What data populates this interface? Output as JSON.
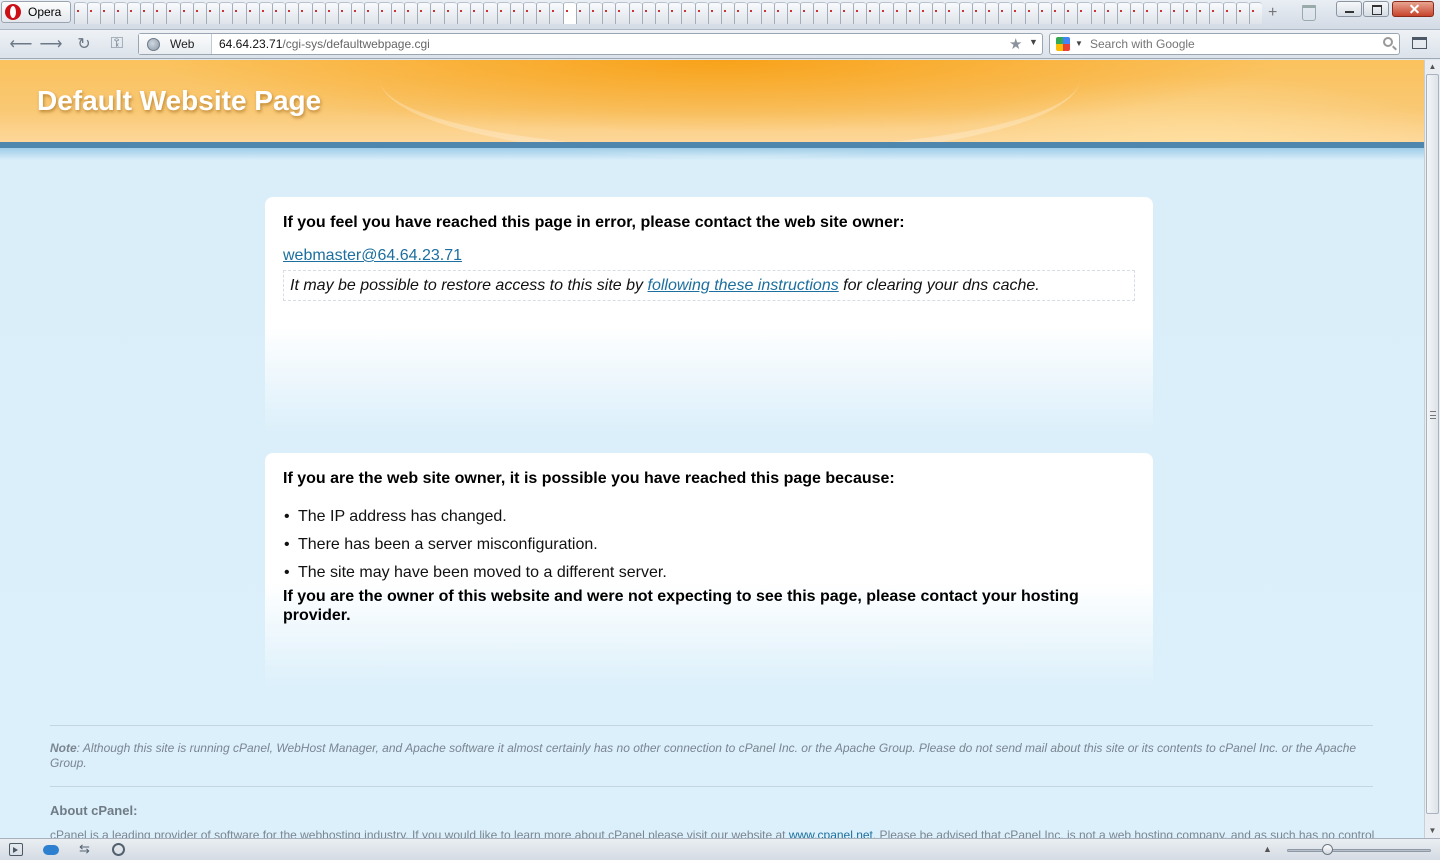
{
  "browser": {
    "menu_label": "Opera",
    "tab_count": 90,
    "site_badge_label": "Web",
    "address": {
      "host": "64.64.23.71",
      "path": "/cgi-sys/defaultwebpage.cgi"
    },
    "search_placeholder": "Search with Google"
  },
  "page": {
    "title": "Default Website Page",
    "error_card": {
      "heading": "If you feel you have reached this page in error, please contact the web site owner:",
      "email_link": "webmaster@64.64.23.71",
      "dns_note_before": "It may be possible to restore access to this site by ",
      "dns_note_link": "following these instructions",
      "dns_note_after": " for clearing your dns cache."
    },
    "owner_card": {
      "heading": "If you are the web site owner, it is possible you have reached this page because:",
      "reasons": [
        "The IP address has changed.",
        "There has been a server misconfiguration.",
        "The site may have been moved to a different server."
      ],
      "closing": "If you are the owner of this website and were not expecting to see this page, please contact your hosting provider."
    },
    "note_label": "Note",
    "note_text": ": Although this site is running cPanel, WebHost Manager, and Apache software it almost certainly has no other connection to cPanel Inc. or the Apache Group. Please do not send mail about this site or its contents to cPanel Inc. or the Apache Group.",
    "about_heading": "About cPanel:",
    "about_text_before": "cPanel is a leading provider of software for the webhosting industry. If you would like to learn more about cPanel please visit our website at ",
    "about_link": "www.cpanel.net",
    "about_text_after": ". Please be advised that cPanel Inc. is not a web hosting company, and as such has no control"
  },
  "colors": {
    "link": "#1c6f9e",
    "banner_orange": "#f9a826",
    "header_rule": "#4f86ad",
    "page_background": "#dcf0fb"
  },
  "icons": [
    "opera-logo-icon",
    "globe-icon",
    "google-icon",
    "star-icon",
    "search-icon",
    "panel-icon",
    "sync-icon",
    "unite-icon",
    "turbo-icon"
  ]
}
